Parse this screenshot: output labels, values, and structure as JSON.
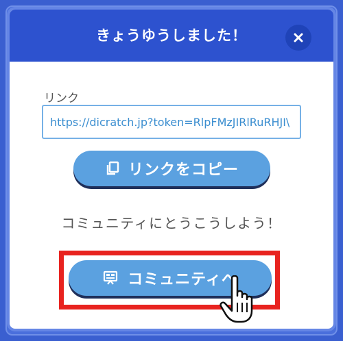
{
  "dialog": {
    "title": "きょうゆうしました！",
    "close_icon": "close-icon"
  },
  "link": {
    "label": "リンク",
    "value": "https://dicratch.jp?token=RlpFMzJIRlRuRHJI\\"
  },
  "copy_button": {
    "label": "リンクをコピー",
    "icon": "copy-icon"
  },
  "tagline": "コミュニティにとうこうしよう！",
  "community_button": {
    "label": "コミュニティへ",
    "icon": "board-icon"
  },
  "colors": {
    "header": "#2d52cf",
    "button": "#5ba1e0",
    "highlight": "#e8231f",
    "link_text": "#3b8ed0"
  }
}
